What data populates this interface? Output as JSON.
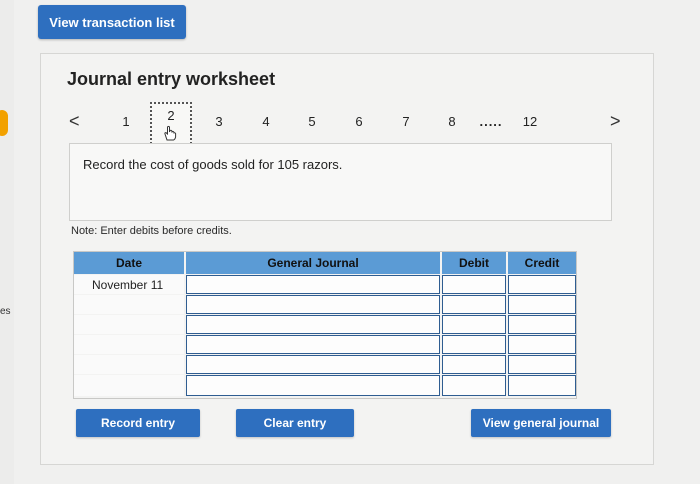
{
  "top": {
    "view_transaction_list": "View transaction list"
  },
  "left_edge": {
    "fragment": "es"
  },
  "worksheet": {
    "title": "Journal entry worksheet",
    "pager": {
      "prev": "<",
      "next": ">",
      "pages": [
        "1",
        "2",
        "3",
        "4",
        "5",
        "6",
        "7",
        "8"
      ],
      "ellipsis": ".....",
      "last": "12",
      "current": "2"
    },
    "prompt": "Record the cost of goods sold for 105 razors.",
    "note": "Note: Enter debits before credits.",
    "table": {
      "headers": {
        "date": "Date",
        "general_journal": "General Journal",
        "debit": "Debit",
        "credit": "Credit"
      },
      "rows": [
        {
          "date": "November 11",
          "account": "",
          "debit": "",
          "credit": ""
        },
        {
          "date": "",
          "account": "",
          "debit": "",
          "credit": ""
        },
        {
          "date": "",
          "account": "",
          "debit": "",
          "credit": ""
        },
        {
          "date": "",
          "account": "",
          "debit": "",
          "credit": ""
        },
        {
          "date": "",
          "account": "",
          "debit": "",
          "credit": ""
        },
        {
          "date": "",
          "account": "",
          "debit": "",
          "credit": ""
        }
      ]
    },
    "buttons": {
      "record_entry": "Record entry",
      "clear_entry": "Clear entry",
      "view_general_journal": "View general journal"
    }
  },
  "colors": {
    "button_blue": "#2e6fbf",
    "header_blue": "#5b9bd5",
    "input_border": "#2f5d91"
  }
}
